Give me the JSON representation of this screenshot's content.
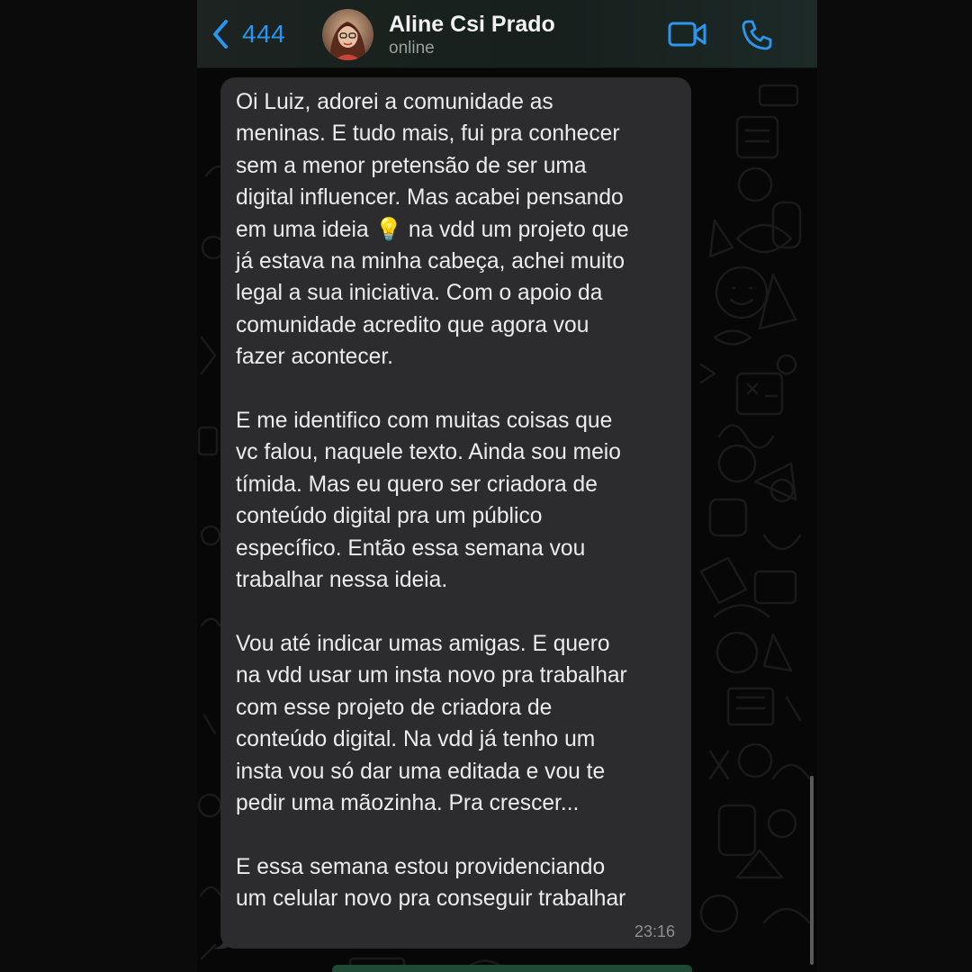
{
  "header": {
    "back_count": "444",
    "contact_name": "Aline Csi Prado",
    "contact_status": "online"
  },
  "message": {
    "paragraphs": [
      "Oi Luiz, adorei a comunidade as\nmeninas. E tudo mais, fui pra conhecer\nsem a menor pretensão de ser uma\ndigital influencer. Mas acabei pensando\nem uma ideia 💡 na vdd um projeto que\njá estava na minha cabeça, achei muito\nlegal a sua iniciativa. Com o apoio da\ncomunidade acredito que agora vou\nfazer acontecer.",
      "E me identifico com muitas coisas que\nvc falou, naquele texto. Ainda sou meio\ntímida. Mas eu quero ser criadora de\nconteúdo digital pra um público\nespecífico. Então essa semana vou\ntrabalhar nessa ideia.",
      "Vou até indicar umas amigas. E quero\nna vdd usar um insta novo pra trabalhar\ncom esse projeto de criadora de\nconteúdo digital. Na vdd já tenho um\ninsta vou só dar uma editada e vou te\npedir uma mãozinha. Pra crescer...",
      "E essa semana estou providenciando\num celular novo pra conseguir trabalhar"
    ],
    "time": "23:16"
  },
  "icons": {
    "back": "chevron-left-icon",
    "video": "video-camera-icon",
    "call": "phone-icon"
  },
  "colors": {
    "accent": "#2b96ef",
    "bubble": "#2c2c2e",
    "header": "#1c2320"
  }
}
